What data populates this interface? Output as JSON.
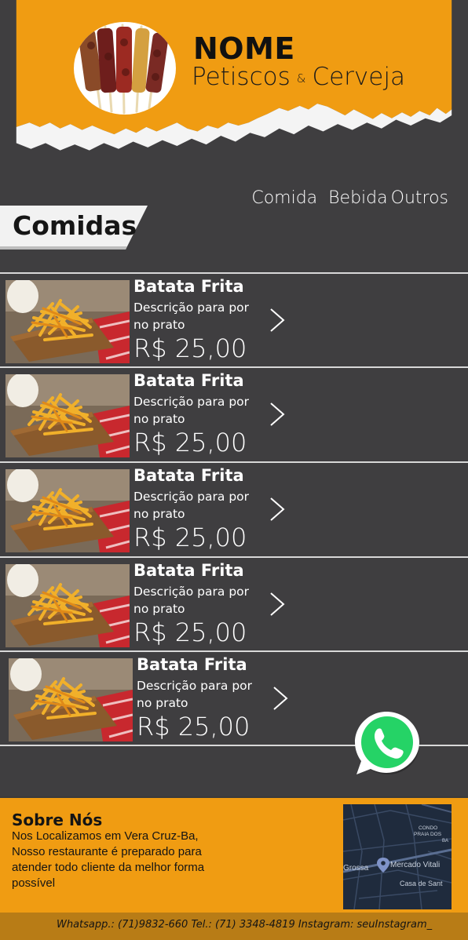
{
  "brand": {
    "name": "NOME",
    "sub_left": "Petiscos",
    "amp": "&",
    "sub_right": "Cerveja"
  },
  "nav": [
    "Comida",
    "Bebida",
    "Outros"
  ],
  "section": {
    "title": "Comidas"
  },
  "items": [
    {
      "name": "Batata Frita",
      "description": "Descrição para por no prato",
      "price": "R$ 25,00"
    },
    {
      "name": "Batata Frita",
      "description": "Descrição para por no prato",
      "price": "R$ 25,00"
    },
    {
      "name": "Batata Frita",
      "description": "Descrição para por no prato",
      "price": "R$ 25,00"
    },
    {
      "name": "Batata Frita",
      "description": "Descrição para por no prato",
      "price": "R$ 25,00"
    },
    {
      "name": "Batata Frita",
      "description": "Descrição para por no prato",
      "price": "R$ 25,00"
    }
  ],
  "about": {
    "title": "Sobre Nós",
    "text": "Nos Localizamos em Vera Cruz-Ba, Nosso restaurante é preparado para atender todo cliente da melhor forma possível"
  },
  "map": {
    "labels": [
      "Grossa",
      "Mercado Vitali",
      "Casa de Sant",
      "CONDO",
      "PRAIA DOS",
      "BA"
    ]
  },
  "footer": {
    "text": "Whatsapp.: (71)9832-660  Tel.: (71) 3348-4819  Instagram: seuInstagram_"
  },
  "colors": {
    "accent": "#f09c12",
    "background": "#3f3e40",
    "footer": "#b87c16",
    "whatsapp": "#25d366"
  },
  "icons": {
    "chevron": "chevron-right-icon",
    "whatsapp": "whatsapp-icon",
    "map_pin": "map-pin-icon"
  }
}
